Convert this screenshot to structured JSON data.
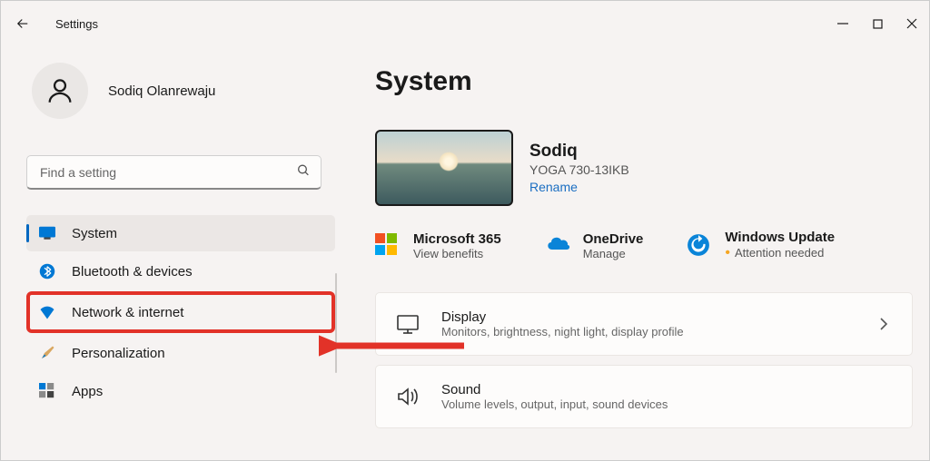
{
  "window": {
    "title": "Settings"
  },
  "profile": {
    "name": "Sodiq Olanrewaju"
  },
  "search": {
    "placeholder": "Find a setting"
  },
  "nav": {
    "items": [
      {
        "label": "System"
      },
      {
        "label": "Bluetooth & devices"
      },
      {
        "label": "Network & internet"
      },
      {
        "label": "Personalization"
      },
      {
        "label": "Apps"
      }
    ]
  },
  "page": {
    "title": "System"
  },
  "device": {
    "name": "Sodiq",
    "model": "YOGA 730-13IKB",
    "rename_label": "Rename"
  },
  "cards": {
    "ms365": {
      "title": "Microsoft 365",
      "sub": "View benefits"
    },
    "onedrive": {
      "title": "OneDrive",
      "sub": "Manage"
    },
    "update": {
      "title": "Windows Update",
      "sub": "Attention needed"
    }
  },
  "settings": {
    "display": {
      "title": "Display",
      "sub": "Monitors, brightness, night light, display profile"
    },
    "sound": {
      "title": "Sound",
      "sub": "Volume levels, output, input, sound devices"
    }
  }
}
